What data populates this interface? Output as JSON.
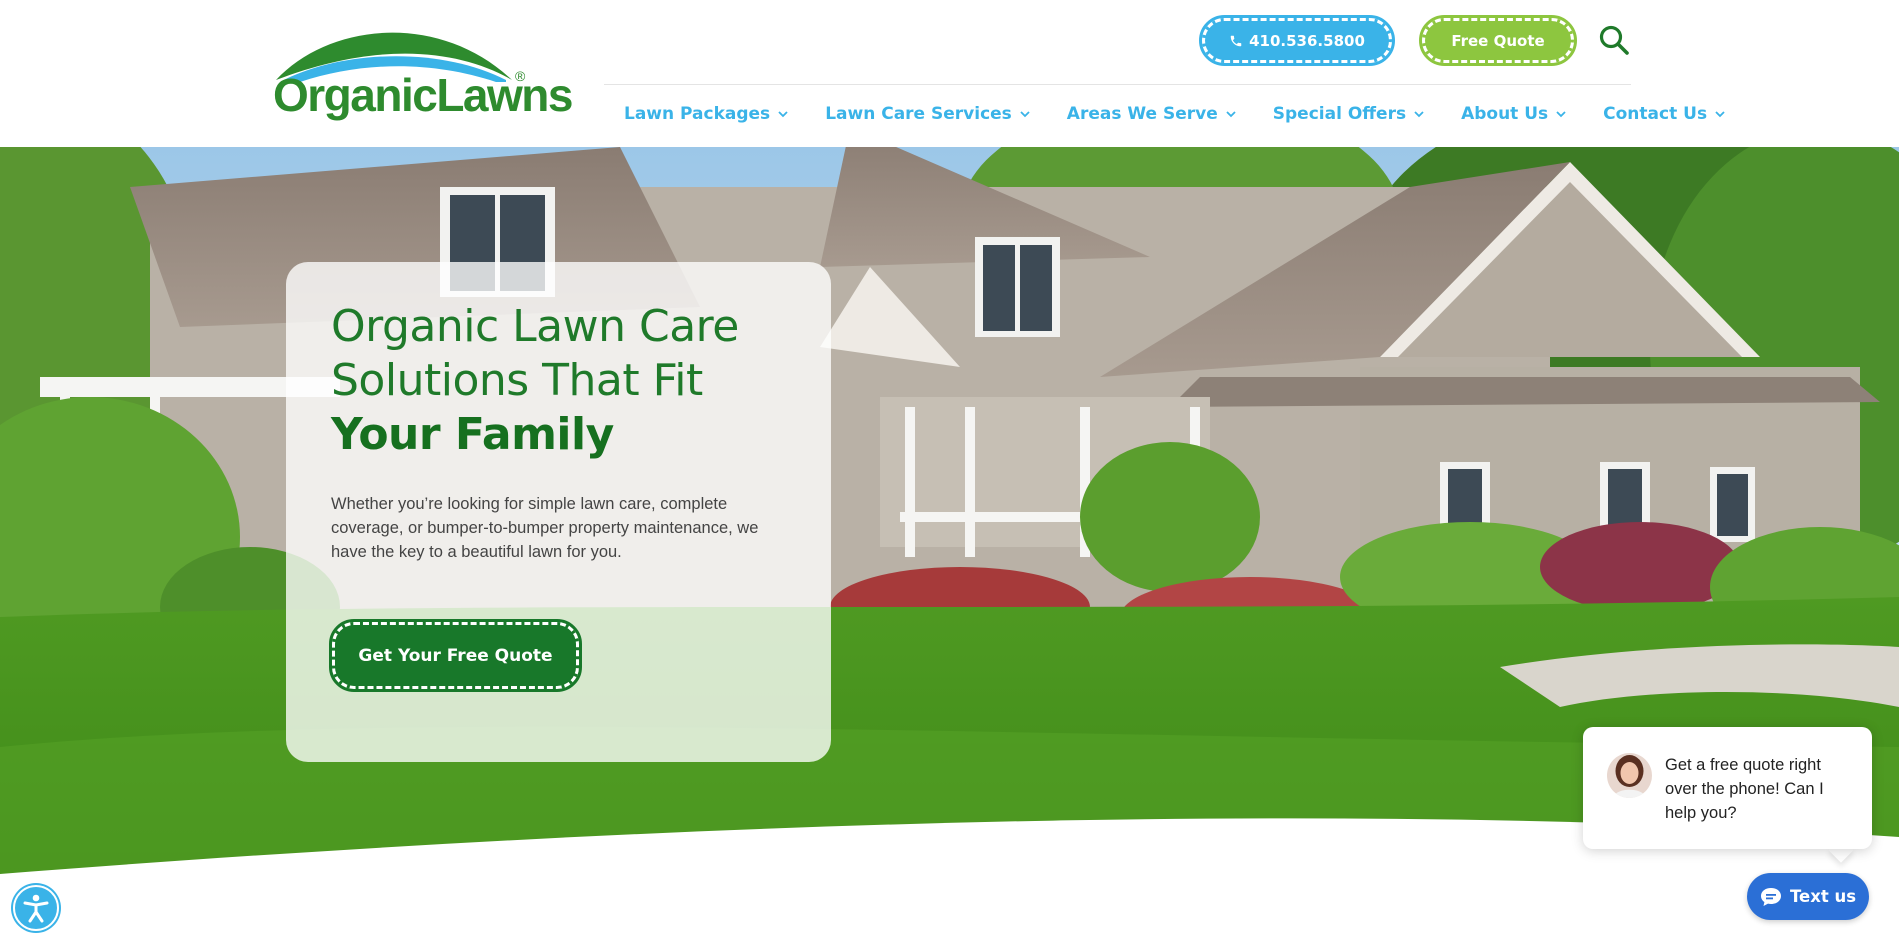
{
  "brand": {
    "name": "OrganicLawns",
    "registered": "®",
    "green": "#2e8b2e",
    "blue": "#3ab3e8",
    "lime": "#8dc63f"
  },
  "header": {
    "phone_label": "410.536.5800",
    "phone_icon": "phone-icon",
    "quote_label": "Free Quote",
    "search_icon": "search-icon"
  },
  "nav": {
    "items": [
      {
        "label": "Lawn Packages"
      },
      {
        "label": "Lawn Care Services"
      },
      {
        "label": "Areas We Serve"
      },
      {
        "label": "Special Offers"
      },
      {
        "label": "About Us"
      },
      {
        "label": "Contact Us"
      }
    ]
  },
  "hero": {
    "title_line1": "Organic Lawn Care",
    "title_line2": "Solutions That Fit",
    "title_line3": "Your Family",
    "body": "Whether you’re looking for simple lawn care, complete coverage, or bumper-to-bumper property maintenance, we have the key to a beautiful lawn for you.",
    "cta_label": "Get Your Free Quote"
  },
  "chat": {
    "message": "Get a free quote right over the phone! Can I help you?",
    "button_label": "Text us",
    "accent": "#2b6fd6"
  },
  "accessibility": {
    "icon": "accessibility-icon"
  }
}
